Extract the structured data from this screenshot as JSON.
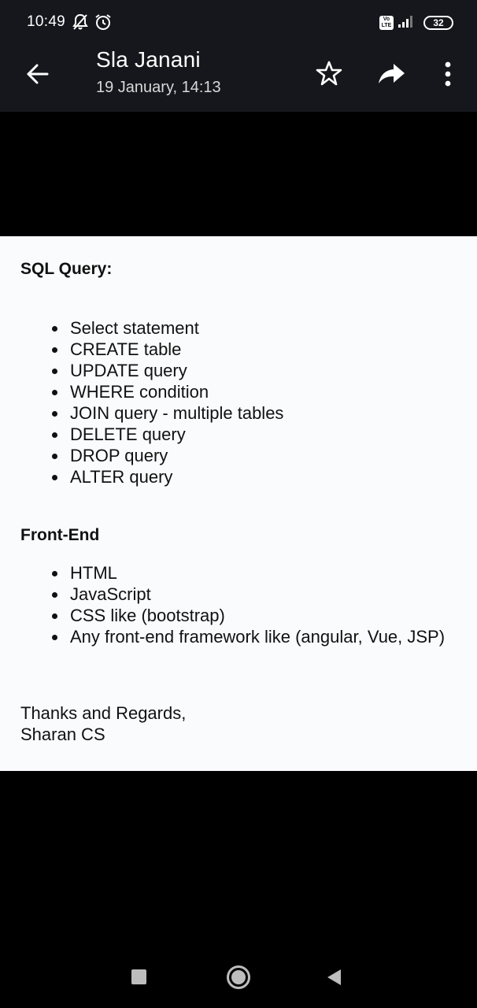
{
  "status_bar": {
    "time": "10:49",
    "icons": [
      "notifications-off-icon",
      "alarm-icon",
      "volte-icon",
      "signal-icon",
      "battery-icon"
    ],
    "volte_label": "Vo LTE",
    "battery_level": "32"
  },
  "toolbar": {
    "sender_name": "Sla Janani",
    "date": "19 January, 14:13",
    "icons": [
      "back-arrow-icon",
      "star-icon",
      "forward-icon",
      "more-vert-icon"
    ]
  },
  "email": {
    "sql_heading": "SQL Query:",
    "sql_items": [
      "Select statement",
      "CREATE table",
      "UPDATE query",
      "WHERE condition",
      "JOIN query - multiple tables",
      "DELETE query",
      "DROP query",
      "ALTER query"
    ],
    "frontend_heading": "Front-End",
    "frontend_items": [
      "HTML",
      "JavaScript",
      "CSS like (bootstrap)",
      "Any front-end framework like (angular, Vue, JSP)"
    ],
    "signoff_line1": "Thanks and Regards,",
    "signoff_line2": "Sharan CS"
  },
  "nav_bar": {
    "icons": [
      "recents-square-icon",
      "home-circle-icon",
      "back-triangle-icon"
    ]
  },
  "colors": {
    "toolbar_bg": "#15171c",
    "body_bg": "#fafbfd",
    "text": "#111111"
  }
}
